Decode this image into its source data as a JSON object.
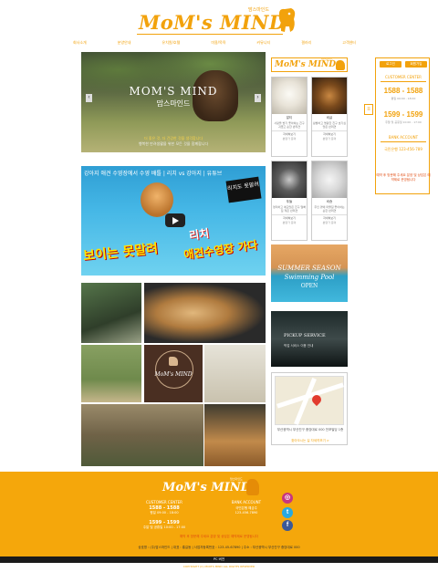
{
  "header": {
    "logo_text": "MoM's MIND",
    "logo_sub": "맘스마인드"
  },
  "nav": {
    "items": [
      "회사소개",
      "분양안내",
      "유치원/호텔",
      "미용/목욕",
      "커뮤니티",
      "갤러리",
      "고객센터"
    ]
  },
  "hero": {
    "title": "MOM'S MIND",
    "subtitle": "맘스마인드",
    "caption1": "더 좋은 것, 더 건강한 것을 생각합니다",
    "caption2": "행복한 반려생활을 위한 모든 것을 함께합니다"
  },
  "video": {
    "title": "강아지 애견 수영장에서 수영 배틀 | 리치 vs 강아지 | 유튜브",
    "badge": "리치도 못말려",
    "cap_left": "보이는 못말려",
    "cap_right1": "리치",
    "cap_right2": "애견수영장 가다"
  },
  "gallery": {
    "logo_text": "MoM's MIND"
  },
  "middle": {
    "logo_text": "MoM's MIND",
    "logo_sub": "맘스마인드",
    "cards": [
      {
        "name": "말티",
        "desc": "사랑을 받기 좋아하는 친구 귀엽고 순한 반려견",
        "btn": "자세히보기",
        "price": "분양가 문의"
      },
      {
        "name": "비글",
        "desc": "활발하고 명랑한 친구 호기심 많은 반려견",
        "btn": "자세히보기",
        "price": "분양가 문의"
      },
      {
        "name": "푸들",
        "desc": "영리하고 애교많은 친구 털빠짐 적은 반려견",
        "btn": "자세히보기",
        "price": "분양가 문의"
      },
      {
        "name": "비숑",
        "desc": "주인 곁에 머물길 좋아하는 순한 반려견",
        "btn": "자세히보기",
        "price": "분양가 문의"
      }
    ],
    "summer": {
      "line1": "SUMMER SEASON",
      "line2": "Swimming Pool",
      "line3": "OPEN"
    },
    "pickup": {
      "line1": "PICKUP SERVICE",
      "line2": "픽업 서비스 이용 안내"
    },
    "map": {
      "address": "부산광역시 부산진구 중앙대로 000 전포빌딩 1층",
      "more": "찾아오시는 길 자세히보기 >"
    }
  },
  "side_tab": "≡",
  "right_panel": {
    "btn1": "로그인",
    "btn2": "회원가입",
    "customer_label": "CUSTOMER CENTER",
    "phone1": "1588 - 1588",
    "hours1": "평일 09:00 - 18:00",
    "phone2": "1599 - 1599",
    "hours2": "주말 및 공휴일 10:00 - 17:00",
    "bank_label": "BANK ACCOUNT",
    "bank_info": "국민은행 123-456-789",
    "notice": "예약 후 방문해 주세요 분양 및 상담은 예약제로 운영됩니다"
  },
  "footer": {
    "logo_text": "MoM's MIND",
    "logo_sub": "맘스마인드",
    "col1_head": "CUSTOMER CENTER",
    "col1_phone1": "1588 - 1588",
    "col1_hours": "평일 09:00 - 18:00",
    "col1_phone2": "1599 - 1599",
    "col1_hours2": "주말 및 공휴일 10:00 - 17:00",
    "col2_head": "BANK ACCOUNT",
    "col2_bank": "국민은행 예금주",
    "col2_account": "123-456-7890",
    "note": "예약 후 방문해 주세요 분양 및 상담은 예약제로 운영됩니다",
    "legal": "상호명 : (주)맘스마인드 | 대표 : 홍길동 | 사업자등록번호 : 123-45-67890 | 주소 : 부산광역시 부산진구 중앙대로 000",
    "bar": "PC 버전",
    "copyright": "COPYRIGHT (C) MOM'S MIND ALL RIGHTS RESERVED"
  },
  "colors": {
    "accent": "#f2a20c",
    "footer_bg": "#f5a70b",
    "notice_red": "#e04b10"
  }
}
